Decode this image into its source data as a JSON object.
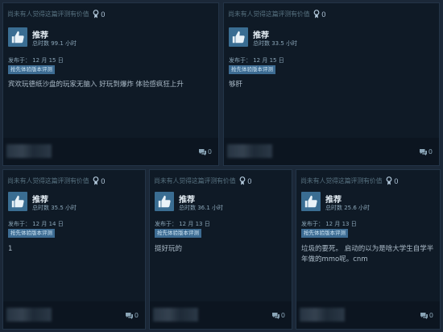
{
  "reviews": [
    {
      "helpful_text": "尚未有人觉得这篇评测有价值",
      "award_count": "0",
      "recommendation": "推荐",
      "hours": "总时数 99.1 小时",
      "date": "发布于： 12 月 15 日",
      "badge": "抢先体验版本评测",
      "body": "宾欢玩德纸沙盘的玩家无脑入 好玩到爆炸 体验感疯狂上升",
      "comment_count": "0"
    },
    {
      "helpful_text": "尚未有人觉得这篇评测有价值",
      "award_count": "0",
      "recommendation": "推荐",
      "hours": "总时数 33.5 小时",
      "date": "发布于： 12 月 15 日",
      "badge": "抢先体验版本评测",
      "body": "够肝",
      "comment_count": "0"
    },
    {
      "helpful_text": "尚未有人觉得这篇评测有价值",
      "award_count": "0",
      "recommendation": "推荐",
      "hours": "总时数 35.5 小时",
      "date": "发布于： 12 月 14 日",
      "badge": "抢先体验版本评测",
      "body": "1",
      "comment_count": "0"
    },
    {
      "helpful_text": "尚未有人觉得这篇评测有价值",
      "award_count": "0",
      "recommendation": "推荐",
      "hours": "总时数 36.1 小时",
      "date": "发布于： 12 月 13 日",
      "badge": "抢先体验版本评测",
      "body": "挺好玩的",
      "comment_count": "0"
    },
    {
      "helpful_text": "尚未有人觉得这篇评测有价值",
      "award_count": "0",
      "recommendation": "推荐",
      "hours": "总时数 25.6 小时",
      "date": "发布于： 12 月 13 日",
      "badge": "抢先体验版本评测",
      "body": "垃圾的要死。 启动的以为是啥大学生自学半年做的mmo呢。cnm",
      "comment_count": "0"
    }
  ],
  "colors": {
    "page_bg": "#1b2838",
    "card_bg": "#0f1a26",
    "thumb_bg": "#3a6d92",
    "badge_bg": "#3d6c93"
  }
}
